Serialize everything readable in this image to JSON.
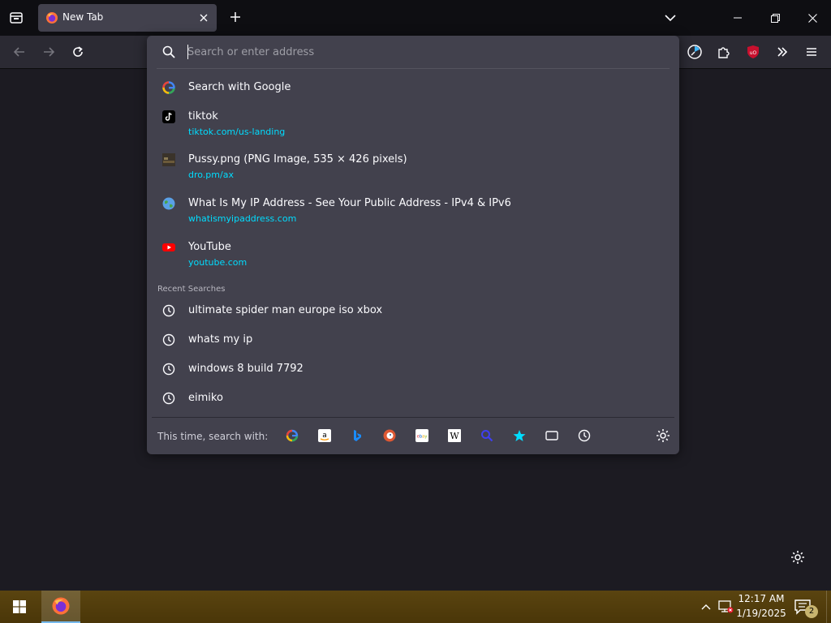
{
  "browser": {
    "tab": {
      "title": "New Tab"
    }
  },
  "urlbar": {
    "placeholder": "Search or enter address",
    "results": [
      {
        "title": "Search with Google",
        "url": "",
        "icon": "google-icon"
      },
      {
        "title": "tiktok",
        "url": "tiktok.com/us-landing",
        "icon": "tiktok-icon"
      },
      {
        "title": "Pussy.png (PNG Image, 535 × 426 pixels)",
        "url": "dro.pm/ax",
        "icon": "image-thumbnail-icon"
      },
      {
        "title": "What Is My IP Address - See Your Public Address - IPv4 & IPv6",
        "url": "whatismyipaddress.com",
        "icon": "globe-icon"
      },
      {
        "title": "YouTube",
        "url": "youtube.com",
        "icon": "youtube-icon"
      }
    ],
    "recent_label": "Recent Searches",
    "recent": [
      "ultimate spider man europe iso xbox",
      "whats my ip",
      "windows 8 build 7792",
      "eimiko"
    ],
    "search_with_label": "This time, search with:",
    "engines": [
      "google-icon",
      "amazon-icon",
      "bing-icon",
      "duckduckgo-icon",
      "ebay-icon",
      "wikipedia-icon",
      "search-magnifier-icon",
      "bookmarks-star-icon",
      "tabs-icon",
      "history-icon"
    ]
  },
  "taskbar": {
    "time": "12:17 AM",
    "date": "1/19/2025",
    "notification_count": "2"
  },
  "colors": {
    "accent_url": "#00ddff",
    "panel": "#42414d",
    "toolbar": "#2b2a33",
    "titlebar": "#0e0e12"
  }
}
